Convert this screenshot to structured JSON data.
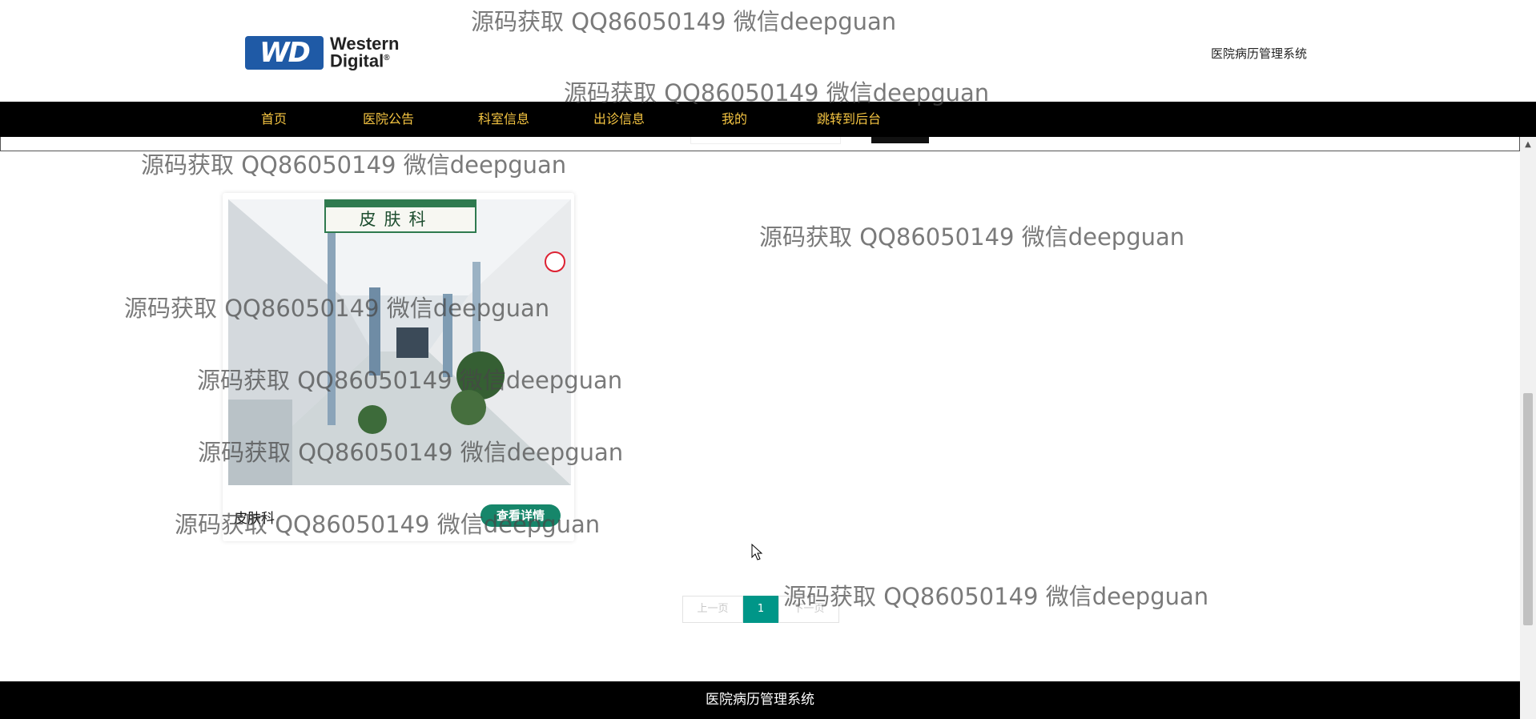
{
  "header": {
    "logo_line1": "Western",
    "logo_line2": "Digital",
    "logo_badge": "WD",
    "site_title": "医院病历管理系统"
  },
  "nav": {
    "items": [
      {
        "label": "首页"
      },
      {
        "label": "医院公告"
      },
      {
        "label": "科室信息"
      },
      {
        "label": "出诊信息"
      },
      {
        "label": "我的"
      },
      {
        "label": "跳转到后台"
      }
    ]
  },
  "card": {
    "image_sign": "皮肤科",
    "label": "皮肤科",
    "detail_button": "查看详情"
  },
  "pagination": {
    "prev": "上一页",
    "current": "1",
    "next": "下一页"
  },
  "footer": {
    "text": "医院病历管理系统"
  },
  "watermark": {
    "text": "源码获取 QQ86050149 微信deepguan"
  },
  "colors": {
    "nav_bg": "#000000",
    "nav_text": "#f5c542",
    "button_green": "#16866a",
    "pager_active": "#009688",
    "logo_blue": "#1f5aa6"
  },
  "icons": {
    "cursor": "mouse-pointer-icon",
    "scroll_up": "scroll-up-arrow-icon"
  }
}
